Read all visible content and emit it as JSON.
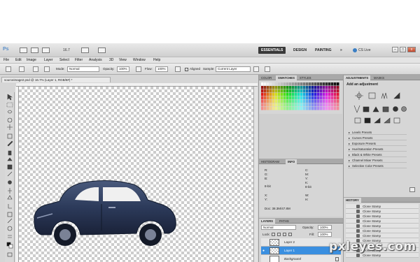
{
  "app": {
    "logo": "Ps",
    "zoom": "16.7",
    "version": "CS Live"
  },
  "workspace": {
    "items": [
      "ESSENTIALS",
      "DESIGN",
      "PAINTING"
    ],
    "more": "»"
  },
  "menu": [
    "File",
    "Edit",
    "Image",
    "Layer",
    "Select",
    "Filter",
    "Analysis",
    "3D",
    "View",
    "Window",
    "Help"
  ],
  "options": {
    "mode_label": "Mode:",
    "mode_value": "Normal",
    "opacity_label": "Opacity:",
    "opacity_value": "100%",
    "flow_label": "Flow:",
    "flow_value": "100%",
    "aligned_label": "Aligned",
    "sample_label": "Sample:",
    "sample_value": "Current Layer"
  },
  "document": {
    "tab": "sourceimage2.psd @ 16.7% (Layer 1, RGB/8#) *"
  },
  "color_panel": {
    "tabs": [
      "COLOR",
      "SWATCHES",
      "STYLES"
    ]
  },
  "info_panel": {
    "tabs": [
      "HISTOGRAM",
      "INFO"
    ],
    "r": "R:",
    "g": "G:",
    "b": "B:",
    "c": "C:",
    "m": "M:",
    "y": "Y:",
    "k": "K:",
    "x": "X:",
    "y2": "Y:",
    "w": "W:",
    "h": "H:",
    "bit1": "8-bit",
    "bit2": "8-bit",
    "doc": "Doc: 38.3M/47.8M"
  },
  "layers_panel": {
    "tabs": [
      "LAYERS",
      "PATHS"
    ],
    "blend": "Normal",
    "opacity_label": "Opacity:",
    "opacity_value": "100%",
    "lock_label": "Lock:",
    "fill_label": "Fill:",
    "fill_value": "100%",
    "layers": [
      {
        "name": "Layer 2",
        "selected": false
      },
      {
        "name": "Layer 1",
        "selected": true
      },
      {
        "name": "Background",
        "selected": false
      }
    ]
  },
  "adjustments_panel": {
    "tabs": [
      "ADJUSTMENTS",
      "MASKS"
    ],
    "title": "Add an adjustment",
    "presets": [
      "Levels Presets",
      "Curves Presets",
      "Exposure Presets",
      "Hue/Saturation Presets",
      "Black & White Presets",
      "Channel Mixer Presets",
      "Selective Color Presets"
    ]
  },
  "history_panel": {
    "tab": "HISTORY",
    "items": [
      "Clone Stamp",
      "Clone Stamp",
      "Clone Stamp",
      "Clone Stamp",
      "Clone Stamp",
      "Clone Stamp",
      "Clone Stamp",
      "Clone Stamp",
      "Clone Stamp",
      "Clone Stamp",
      "Clone Stamp"
    ]
  },
  "watermark": "pxleyes.com",
  "colors": {
    "selection": "#3a8fe0",
    "workspace_active": "#3a3a3a",
    "car_body": "#2c3a5a"
  }
}
